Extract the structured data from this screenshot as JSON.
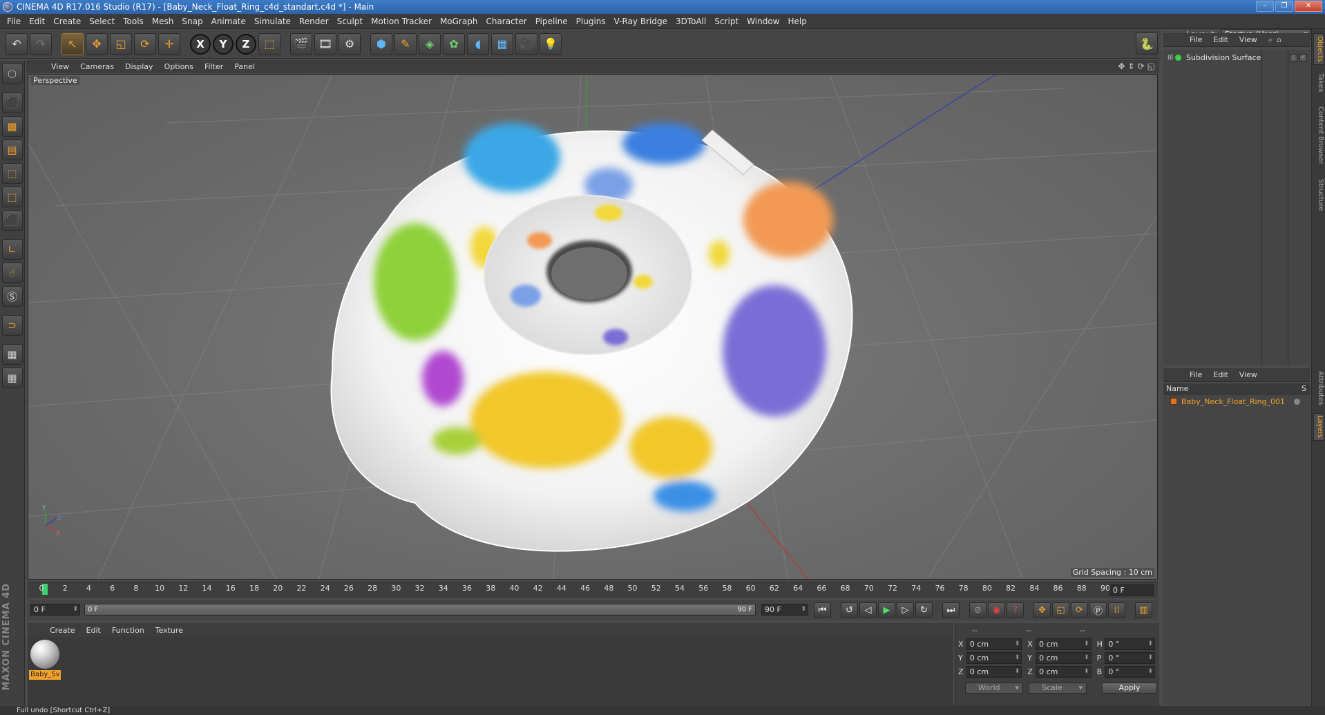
{
  "window": {
    "title": "CINEMA 4D R17.016 Studio (R17) - [Baby_Neck_Float_Ring_c4d_standart.c4d *] - Main",
    "buttons": [
      "–",
      "❐",
      "✕"
    ]
  },
  "menubar": {
    "items": [
      "File",
      "Edit",
      "Create",
      "Select",
      "Tools",
      "Mesh",
      "Snap",
      "Animate",
      "Simulate",
      "Render",
      "Sculpt",
      "Motion Tracker",
      "MoGraph",
      "Character",
      "Pipeline",
      "Plugins",
      "V-Ray Bridge",
      "3DToAll",
      "Script",
      "Window",
      "Help"
    ],
    "layout_label": "Layout:",
    "layout_value": "Startup (User)"
  },
  "viewport": {
    "menu": [
      "View",
      "Cameras",
      "Display",
      "Options",
      "Filter",
      "Panel"
    ],
    "camera_label": "Perspective",
    "grid_spacing": "Grid Spacing : 10 cm",
    "axis_labels": {
      "y": "Y",
      "x": "X",
      "z": "Z"
    }
  },
  "timeline": {
    "ticks": [
      "0",
      "2",
      "4",
      "6",
      "8",
      "10",
      "12",
      "14",
      "16",
      "18",
      "20",
      "22",
      "24",
      "26",
      "28",
      "30",
      "32",
      "34",
      "36",
      "38",
      "40",
      "42",
      "44",
      "46",
      "48",
      "50",
      "52",
      "54",
      "56",
      "58",
      "60",
      "62",
      "64",
      "66",
      "68",
      "70",
      "72",
      "74",
      "76",
      "78",
      "80",
      "82",
      "84",
      "86",
      "88",
      "90"
    ],
    "current_frame": "0 F",
    "start_field": "0 F",
    "range_start": "0 F",
    "range_end": "90 F",
    "end_field": "90 F"
  },
  "material_manager": {
    "menu": [
      "Create",
      "Edit",
      "Function",
      "Texture"
    ],
    "material_name": "Baby_Sv"
  },
  "coordinates": {
    "headers": [
      "--",
      "--",
      "--"
    ],
    "rows": [
      {
        "a": "X",
        "av": "0 cm",
        "b": "X",
        "bv": "0 cm",
        "c": "H",
        "cv": "0 °"
      },
      {
        "a": "Y",
        "av": "0 cm",
        "b": "Y",
        "bv": "0 cm",
        "c": "P",
        "cv": "0 °"
      },
      {
        "a": "Z",
        "av": "0 cm",
        "b": "Z",
        "bv": "0 cm",
        "c": "B",
        "cv": "0 °"
      }
    ],
    "mode1": "World",
    "mode2": "Scale",
    "apply": "Apply"
  },
  "object_manager": {
    "menu": [
      "File",
      "Edit",
      "View"
    ],
    "objects": [
      {
        "name": "Subdivision Surface"
      }
    ]
  },
  "layer_manager": {
    "menu": [
      "File",
      "Edit",
      "View"
    ],
    "col_name": "Name",
    "col_s": "S",
    "layers": [
      {
        "name": "Baby_Neck_Float_Ring_001"
      }
    ]
  },
  "right_tabs": [
    "Objects",
    "Takes",
    "Content Browser",
    "Structure",
    "Attributes",
    "Layers"
  ],
  "status": "Full undo [Shortcut Ctrl+Z]",
  "brand": "MAXON CINEMA 4D",
  "colors": {
    "accent": "#f2a22c",
    "play": "#4ee06d",
    "object_green": "#4fc84f",
    "layer_orange": "#d9722a"
  }
}
